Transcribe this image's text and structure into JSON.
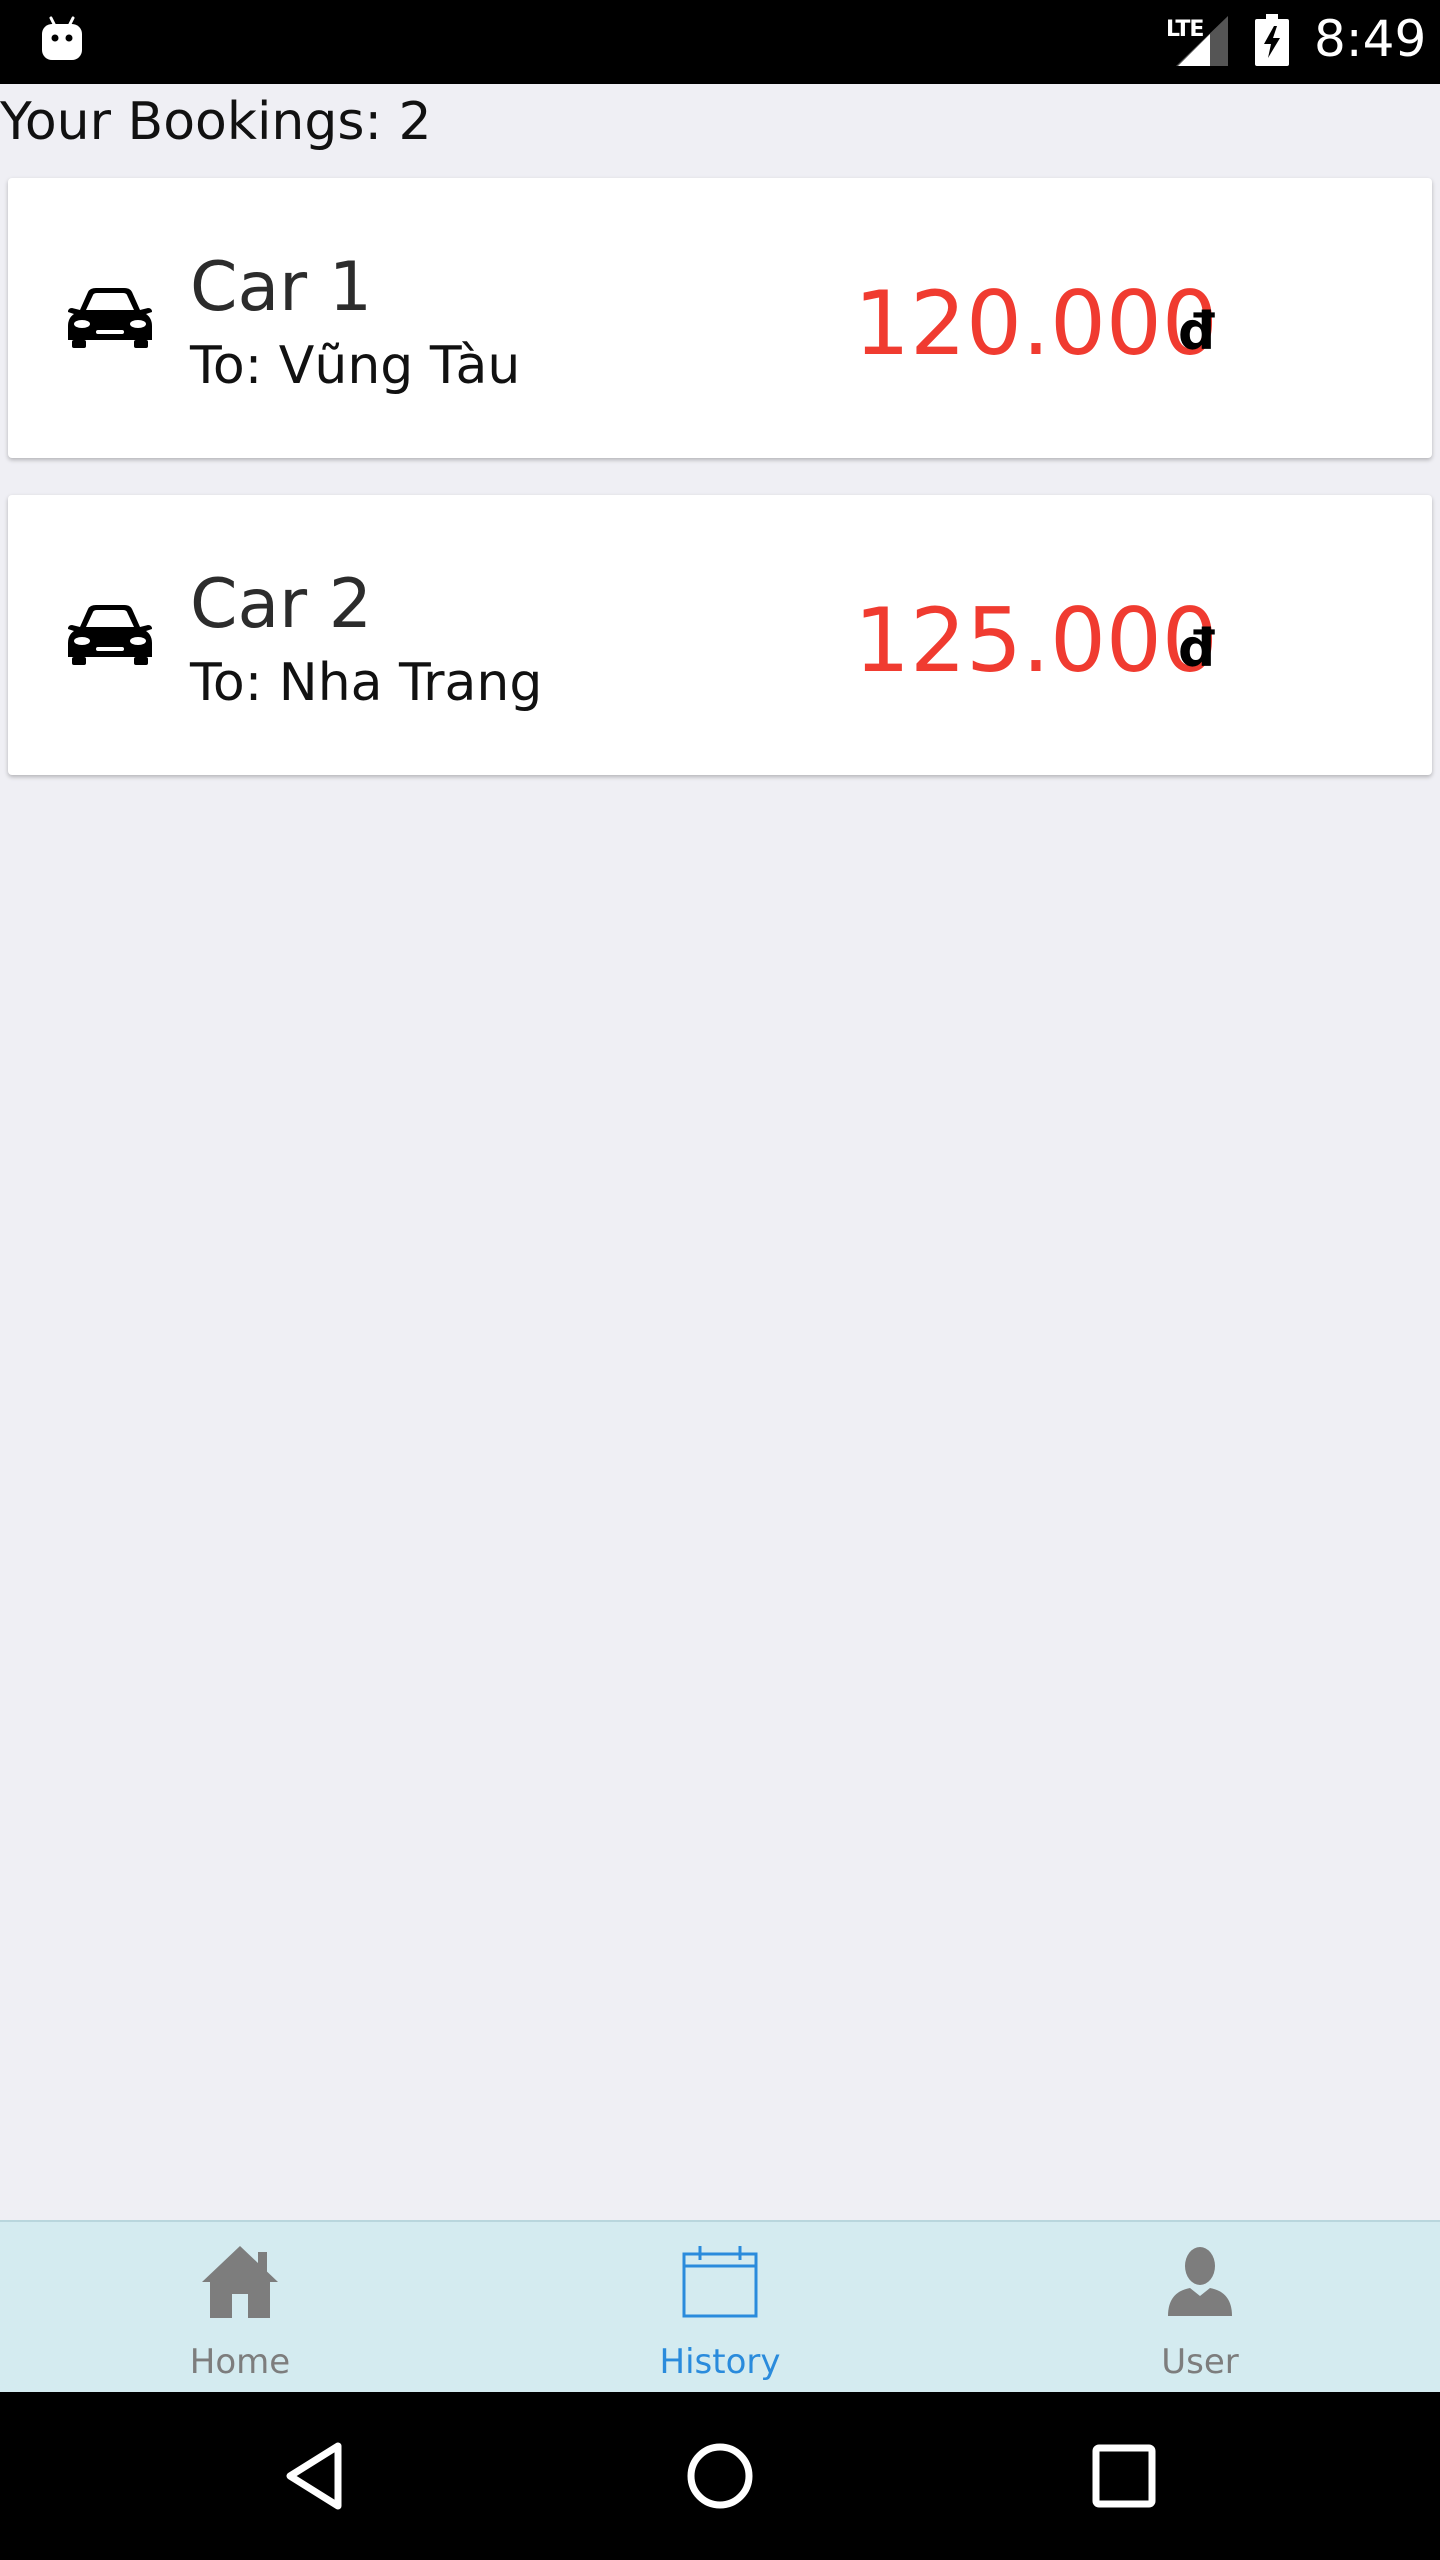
{
  "status_bar": {
    "network_label": "LTE",
    "time": "8:49",
    "icons": [
      "android-icon",
      "signal-icon",
      "battery-charging-icon"
    ]
  },
  "header": {
    "bookings_count": "Your Bookings: 2"
  },
  "bookings": [
    {
      "car": "Car 1",
      "destination": "To: Vũng Tàu",
      "price": "120.000",
      "currency": "đ"
    },
    {
      "car": "Car 2",
      "destination": "To: Nha Trang",
      "price": "125.000",
      "currency": "đ"
    }
  ],
  "tabs": [
    {
      "label": "Home",
      "icon": "home-icon",
      "active": false
    },
    {
      "label": "History",
      "icon": "calendar-icon",
      "active": true
    },
    {
      "label": "User",
      "icon": "user-icon",
      "active": false
    }
  ],
  "colors": {
    "price": "#f03b30",
    "active_tab": "#2a8bdc",
    "inactive_tab": "#7d7d7d",
    "tab_bar_bg": "#d4ebf0",
    "page_bg": "#efeff4"
  }
}
